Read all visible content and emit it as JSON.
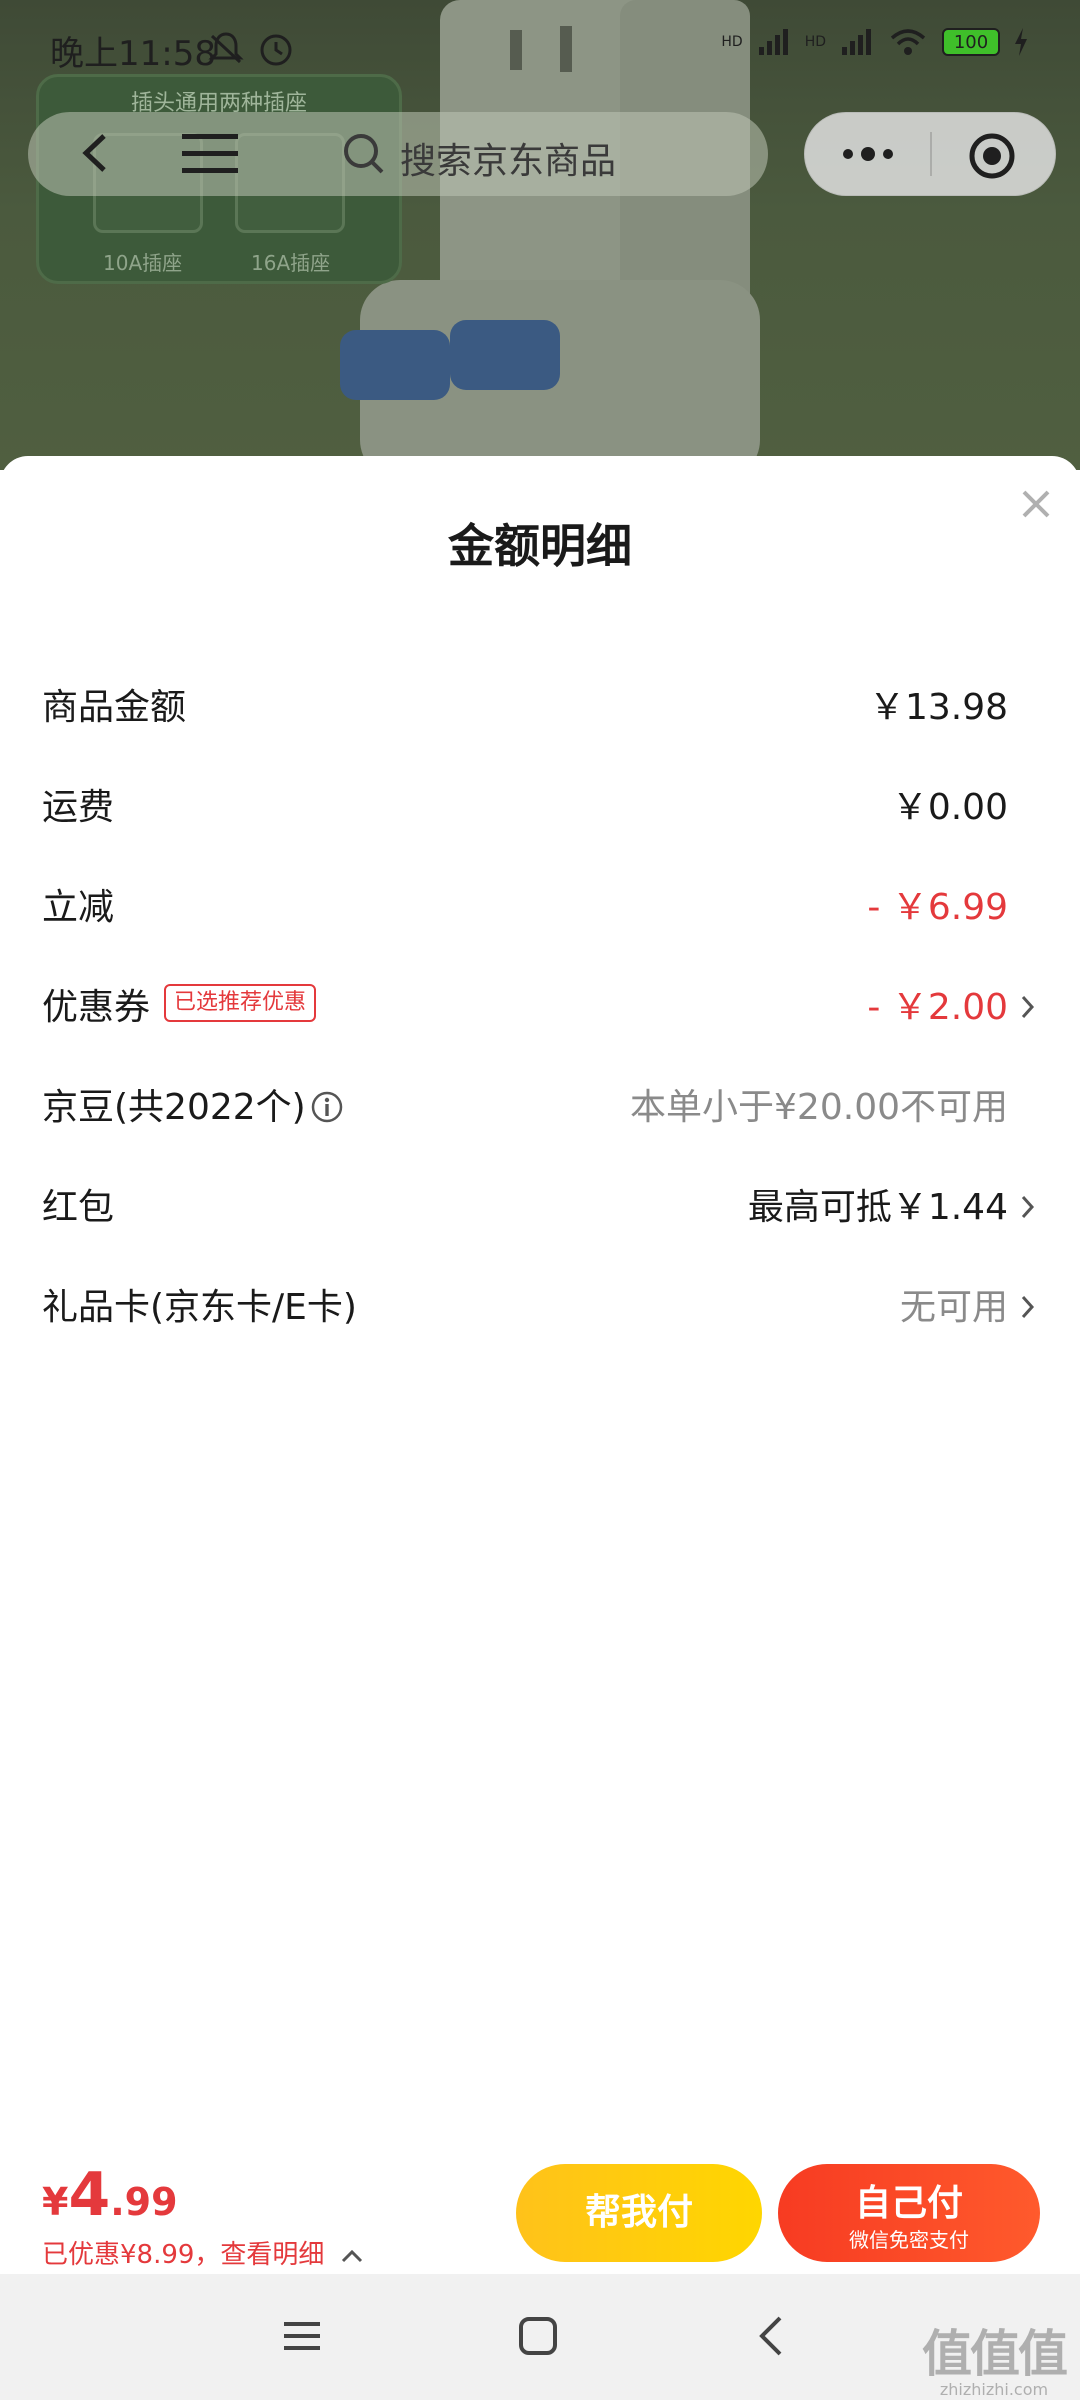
{
  "status_bar": {
    "time": "晚上11:58",
    "network_1": "HD",
    "network_2": "HD",
    "battery": "100"
  },
  "background": {
    "inset_title": "插头通用两种插座",
    "inset_label_1": "10A插座",
    "inset_label_2": "16A插座"
  },
  "nav": {
    "search_placeholder": "搜索京东商品"
  },
  "sheet": {
    "title": "金额明细",
    "rows": [
      {
        "label": "商品金额",
        "value": "￥13.98"
      },
      {
        "label": "运费",
        "value": "￥0.00"
      },
      {
        "label": "立减",
        "value": "- ￥6.99"
      },
      {
        "label": "优惠券",
        "badge": "已选推荐优惠",
        "value": "- ￥2.00"
      },
      {
        "label": "京豆(共2022个)",
        "value": "本单小于¥20.00不可用"
      },
      {
        "label": "红包",
        "value": "最高可抵￥1.44"
      },
      {
        "label": "礼品卡(京东卡/E卡)",
        "value": "无可用"
      }
    ]
  },
  "bottom_bar": {
    "currency": "¥",
    "total_int": "4",
    "total_dec": ".99",
    "discount_detail": "已优惠¥8.99，查看明细",
    "help_pay_label": "帮我付",
    "self_pay_label": "自己付",
    "self_pay_sub": "微信免密支付"
  },
  "watermark": {
    "text": "值值值",
    "url": "zhizhizhi.com"
  },
  "colors": {
    "accent_red": "#e4393c",
    "help_button": "#ffc21a",
    "self_button": "#f73b22"
  }
}
